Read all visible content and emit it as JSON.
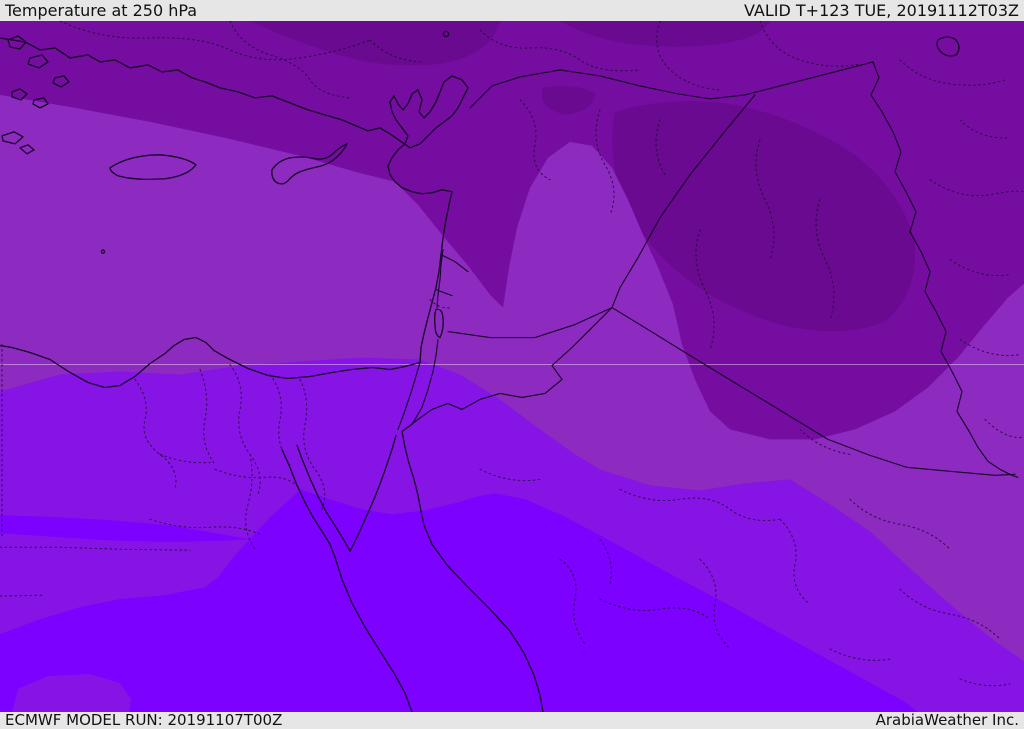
{
  "header": {
    "title": "Temperature at 250 hPa",
    "valid_label": "VALID T+123 TUE, 20191112T03Z"
  },
  "footer": {
    "model_run": "ECMWF MODEL RUN: 20191107T00Z",
    "brand": "ArabiaWeather Inc."
  },
  "chrome_colors": {
    "bar_background": "#e6e6e6",
    "bar_text": "#111111"
  },
  "map": {
    "parameter": "Temperature",
    "level": "250 hPa",
    "model": "ECMWF",
    "bands": [
      {
        "name": "band-1-darkest",
        "color": "#6a0a90"
      },
      {
        "name": "band-2-dark",
        "color": "#750ea0"
      },
      {
        "name": "band-3-medium",
        "color": "#8d2ac0"
      },
      {
        "name": "band-4-bright",
        "color": "#8614e4"
      },
      {
        "name": "band-5-brightest",
        "color": "#7d01ff"
      }
    ],
    "line_colors": {
      "coast_border": "#170428",
      "admin_boundary": "#26073c",
      "graticule": "#dcc9ef"
    }
  }
}
